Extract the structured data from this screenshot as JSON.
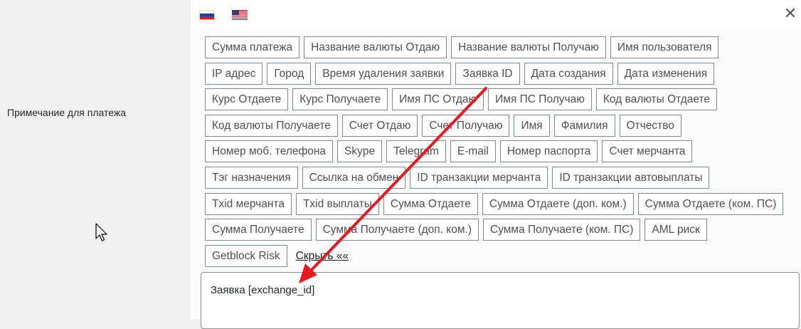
{
  "field": {
    "label": "Примечание для платежа"
  },
  "languages": [
    {
      "code": "ru",
      "icon": "russia-flag-icon"
    },
    {
      "code": "en",
      "icon": "usa-flag-icon"
    }
  ],
  "close": {
    "icon": "close-icon",
    "glyph": "✕"
  },
  "tag_rows": [
    [
      "Сумма платежа",
      "Название валюты Отдаю",
      "Название валюты Получаю",
      "Имя пользователя"
    ],
    [
      "IP адрес",
      "Город",
      "Время удаления заявки",
      "Заявка ID",
      "Дата создания",
      "Дата изменения"
    ],
    [
      "Курс Отдаете",
      "Курс Получаете",
      "Имя ПС Отдаю",
      "Имя ПС Получаю",
      "Код валюты Отдаете"
    ],
    [
      "Код валюты Получаете",
      "Счет Отдаю",
      "Счет Получаю",
      "Имя",
      "Фамилия",
      "Отчество"
    ],
    [
      "Номер моб. телефона",
      "Skype",
      "Telegram",
      "E-mail",
      "Номер паспорта",
      "Счет мерчанта"
    ],
    [
      "Тэг назначения",
      "Ссылка на обмен",
      "ID транзакции мерчанта",
      "ID транзакции автовыплаты"
    ],
    [
      "Txid мерчанта",
      "Txid выплаты",
      "Сумма Отдаете",
      "Сумма Отдаете (доп. ком.)",
      "Сумма Отдаете (ком. ПС)"
    ],
    [
      "Сумма Получаете",
      "Сумма Получаете (доп. ком.)",
      "Сумма Получаете (ком. ПС)",
      "AML риск"
    ],
    [
      "Getblock Risk"
    ]
  ],
  "hide_link": "Скрыть ««",
  "textarea": {
    "value": "Заявка [exchange_id]"
  },
  "colors": {
    "arrow": "#e8191f",
    "tag_border": "#7e8993",
    "tag_text": "#505050"
  },
  "annotation": {
    "icon": "red-arrow-annotation"
  },
  "cursor": {
    "icon": "mouse-pointer-icon"
  }
}
